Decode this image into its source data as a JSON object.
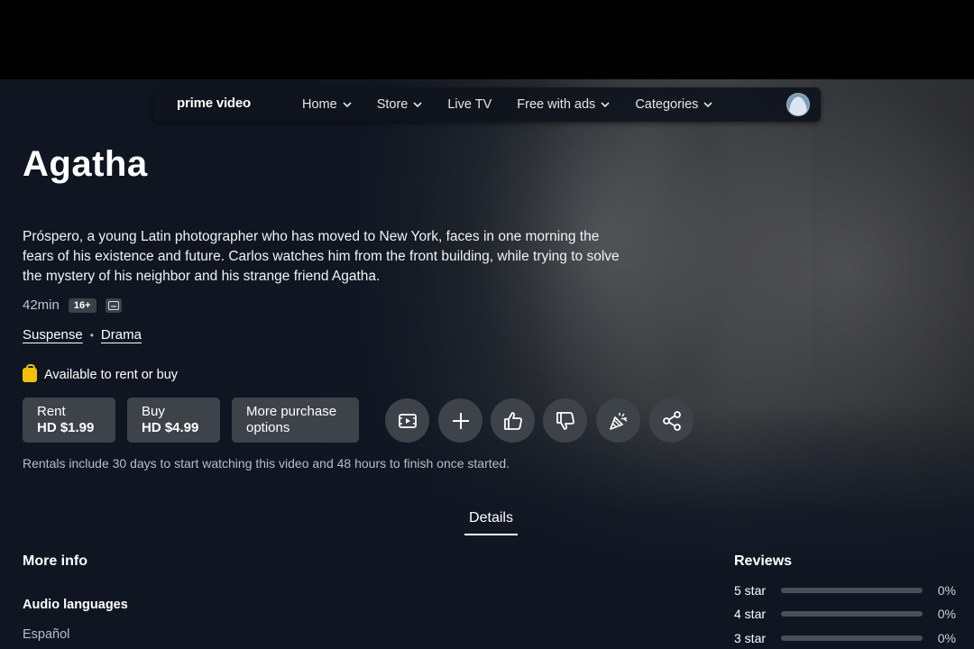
{
  "nav": {
    "logo": "prime video",
    "items": [
      {
        "label": "Home",
        "dropdown": true
      },
      {
        "label": "Store",
        "dropdown": true
      },
      {
        "label": "Live TV",
        "dropdown": false
      },
      {
        "label": "Free with ads",
        "dropdown": true
      },
      {
        "label": "Categories",
        "dropdown": true
      }
    ]
  },
  "title": "Agatha",
  "synopsis": "Próspero, a young Latin photographer who has moved to New York, faces in one morning the fears of his existence and future. Carlos watches him from the front building, while trying to solve the mystery of his neighbor and his strange friend Agatha.",
  "meta": {
    "duration": "42min",
    "rating": "16+",
    "cc_icon": "subtitles-icon"
  },
  "genres": [
    "Suspense",
    "Drama"
  ],
  "availability": {
    "icon": "shopping-bag-icon",
    "text": "Available to rent or buy",
    "icon_color": "#f2c200"
  },
  "purchase": {
    "rent": {
      "line1": "Rent",
      "line2": "HD $1.99"
    },
    "buy": {
      "line1": "Buy",
      "line2": "HD $4.99"
    },
    "more": {
      "line1": "More purchase",
      "line2": "options"
    }
  },
  "actions": [
    "trailer-icon",
    "add-watchlist-icon",
    "thumbs-up-icon",
    "thumbs-down-icon",
    "party-icon",
    "share-icon"
  ],
  "rental_note": "Rentals include 30 days to start watching this video and 48 hours to finish once started.",
  "tabs": {
    "details": "Details"
  },
  "more_info": {
    "heading": "More info",
    "audio_heading": "Audio languages",
    "audio_value": "Español"
  },
  "reviews": {
    "heading": "Reviews",
    "rows": [
      {
        "label": "5 star",
        "pct": "0%",
        "fraction": 0
      },
      {
        "label": "4 star",
        "pct": "0%",
        "fraction": 0
      },
      {
        "label": "3 star",
        "pct": "0%",
        "fraction": 0
      }
    ]
  }
}
